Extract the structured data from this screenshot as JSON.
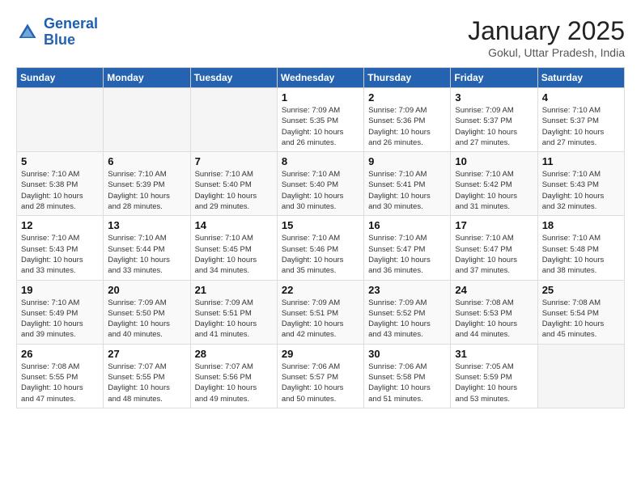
{
  "header": {
    "logo_line1": "General",
    "logo_line2": "Blue",
    "title": "January 2025",
    "subtitle": "Gokul, Uttar Pradesh, India"
  },
  "weekdays": [
    "Sunday",
    "Monday",
    "Tuesday",
    "Wednesday",
    "Thursday",
    "Friday",
    "Saturday"
  ],
  "weeks": [
    [
      {
        "day": "",
        "info": ""
      },
      {
        "day": "",
        "info": ""
      },
      {
        "day": "",
        "info": ""
      },
      {
        "day": "1",
        "info": "Sunrise: 7:09 AM\nSunset: 5:35 PM\nDaylight: 10 hours\nand 26 minutes."
      },
      {
        "day": "2",
        "info": "Sunrise: 7:09 AM\nSunset: 5:36 PM\nDaylight: 10 hours\nand 26 minutes."
      },
      {
        "day": "3",
        "info": "Sunrise: 7:09 AM\nSunset: 5:37 PM\nDaylight: 10 hours\nand 27 minutes."
      },
      {
        "day": "4",
        "info": "Sunrise: 7:10 AM\nSunset: 5:37 PM\nDaylight: 10 hours\nand 27 minutes."
      }
    ],
    [
      {
        "day": "5",
        "info": "Sunrise: 7:10 AM\nSunset: 5:38 PM\nDaylight: 10 hours\nand 28 minutes."
      },
      {
        "day": "6",
        "info": "Sunrise: 7:10 AM\nSunset: 5:39 PM\nDaylight: 10 hours\nand 28 minutes."
      },
      {
        "day": "7",
        "info": "Sunrise: 7:10 AM\nSunset: 5:40 PM\nDaylight: 10 hours\nand 29 minutes."
      },
      {
        "day": "8",
        "info": "Sunrise: 7:10 AM\nSunset: 5:40 PM\nDaylight: 10 hours\nand 30 minutes."
      },
      {
        "day": "9",
        "info": "Sunrise: 7:10 AM\nSunset: 5:41 PM\nDaylight: 10 hours\nand 30 minutes."
      },
      {
        "day": "10",
        "info": "Sunrise: 7:10 AM\nSunset: 5:42 PM\nDaylight: 10 hours\nand 31 minutes."
      },
      {
        "day": "11",
        "info": "Sunrise: 7:10 AM\nSunset: 5:43 PM\nDaylight: 10 hours\nand 32 minutes."
      }
    ],
    [
      {
        "day": "12",
        "info": "Sunrise: 7:10 AM\nSunset: 5:43 PM\nDaylight: 10 hours\nand 33 minutes."
      },
      {
        "day": "13",
        "info": "Sunrise: 7:10 AM\nSunset: 5:44 PM\nDaylight: 10 hours\nand 33 minutes."
      },
      {
        "day": "14",
        "info": "Sunrise: 7:10 AM\nSunset: 5:45 PM\nDaylight: 10 hours\nand 34 minutes."
      },
      {
        "day": "15",
        "info": "Sunrise: 7:10 AM\nSunset: 5:46 PM\nDaylight: 10 hours\nand 35 minutes."
      },
      {
        "day": "16",
        "info": "Sunrise: 7:10 AM\nSunset: 5:47 PM\nDaylight: 10 hours\nand 36 minutes."
      },
      {
        "day": "17",
        "info": "Sunrise: 7:10 AM\nSunset: 5:47 PM\nDaylight: 10 hours\nand 37 minutes."
      },
      {
        "day": "18",
        "info": "Sunrise: 7:10 AM\nSunset: 5:48 PM\nDaylight: 10 hours\nand 38 minutes."
      }
    ],
    [
      {
        "day": "19",
        "info": "Sunrise: 7:10 AM\nSunset: 5:49 PM\nDaylight: 10 hours\nand 39 minutes."
      },
      {
        "day": "20",
        "info": "Sunrise: 7:09 AM\nSunset: 5:50 PM\nDaylight: 10 hours\nand 40 minutes."
      },
      {
        "day": "21",
        "info": "Sunrise: 7:09 AM\nSunset: 5:51 PM\nDaylight: 10 hours\nand 41 minutes."
      },
      {
        "day": "22",
        "info": "Sunrise: 7:09 AM\nSunset: 5:51 PM\nDaylight: 10 hours\nand 42 minutes."
      },
      {
        "day": "23",
        "info": "Sunrise: 7:09 AM\nSunset: 5:52 PM\nDaylight: 10 hours\nand 43 minutes."
      },
      {
        "day": "24",
        "info": "Sunrise: 7:08 AM\nSunset: 5:53 PM\nDaylight: 10 hours\nand 44 minutes."
      },
      {
        "day": "25",
        "info": "Sunrise: 7:08 AM\nSunset: 5:54 PM\nDaylight: 10 hours\nand 45 minutes."
      }
    ],
    [
      {
        "day": "26",
        "info": "Sunrise: 7:08 AM\nSunset: 5:55 PM\nDaylight: 10 hours\nand 47 minutes."
      },
      {
        "day": "27",
        "info": "Sunrise: 7:07 AM\nSunset: 5:55 PM\nDaylight: 10 hours\nand 48 minutes."
      },
      {
        "day": "28",
        "info": "Sunrise: 7:07 AM\nSunset: 5:56 PM\nDaylight: 10 hours\nand 49 minutes."
      },
      {
        "day": "29",
        "info": "Sunrise: 7:06 AM\nSunset: 5:57 PM\nDaylight: 10 hours\nand 50 minutes."
      },
      {
        "day": "30",
        "info": "Sunrise: 7:06 AM\nSunset: 5:58 PM\nDaylight: 10 hours\nand 51 minutes."
      },
      {
        "day": "31",
        "info": "Sunrise: 7:05 AM\nSunset: 5:59 PM\nDaylight: 10 hours\nand 53 minutes."
      },
      {
        "day": "",
        "info": ""
      }
    ]
  ]
}
